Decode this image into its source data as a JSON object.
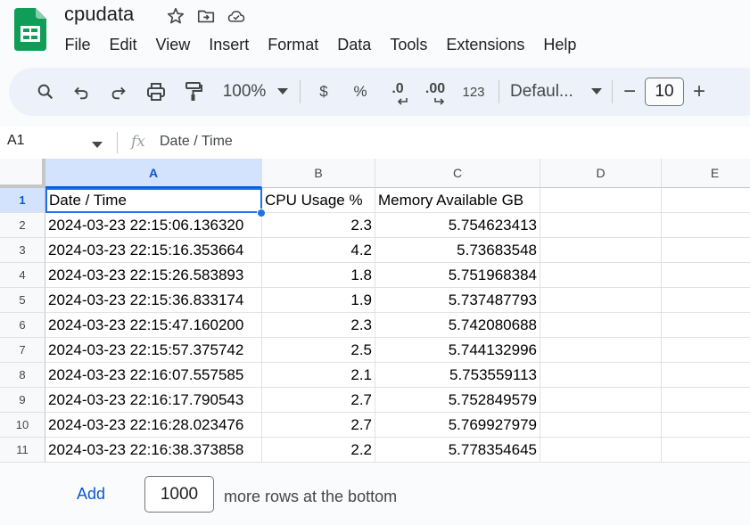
{
  "document": {
    "title": "cpudata"
  },
  "menu": [
    "File",
    "Edit",
    "View",
    "Insert",
    "Format",
    "Data",
    "Tools",
    "Extensions",
    "Help"
  ],
  "toolbar": {
    "zoom": "100%",
    "currency": "$",
    "percent": "%",
    "decrease_decimal": ".0",
    "increase_decimal": ".00",
    "number_format": "123",
    "font": "Defaul...",
    "font_size": "10",
    "decrease_size": "−",
    "increase_size": "+"
  },
  "formula_bar": {
    "cell_ref": "A1",
    "fx": "fx",
    "content": "Date / Time"
  },
  "columns": [
    "A",
    "B",
    "C",
    "D",
    "E"
  ],
  "rows": [
    {
      "num": "1",
      "a": "Date / Time",
      "b": "CPU Usage %",
      "c": "Memory Available GB"
    },
    {
      "num": "2",
      "a": "2024-03-23 22:15:06.136320",
      "b": "2.3",
      "c": "5.754623413"
    },
    {
      "num": "3",
      "a": "2024-03-23 22:15:16.353664",
      "b": "4.2",
      "c": "5.73683548"
    },
    {
      "num": "4",
      "a": "2024-03-23 22:15:26.583893",
      "b": "1.8",
      "c": "5.751968384"
    },
    {
      "num": "5",
      "a": "2024-03-23 22:15:36.833174",
      "b": "1.9",
      "c": "5.737487793"
    },
    {
      "num": "6",
      "a": "2024-03-23 22:15:47.160200",
      "b": "2.3",
      "c": "5.742080688"
    },
    {
      "num": "7",
      "a": "2024-03-23 22:15:57.375742",
      "b": "2.5",
      "c": "5.744132996"
    },
    {
      "num": "8",
      "a": "2024-03-23 22:16:07.557585",
      "b": "2.1",
      "c": "5.753559113"
    },
    {
      "num": "9",
      "a": "2024-03-23 22:16:17.790543",
      "b": "2.7",
      "c": "5.752849579"
    },
    {
      "num": "10",
      "a": "2024-03-23 22:16:28.023476",
      "b": "2.7",
      "c": "5.769927979"
    },
    {
      "num": "11",
      "a": "2024-03-23 22:16:38.373858",
      "b": "2.2",
      "c": "5.778354645"
    }
  ],
  "bottom": {
    "add_label": "Add",
    "rows_to_add": "1000",
    "suffix": "more rows at the bottom"
  },
  "colors": {
    "brand_green": "#0f9d58",
    "accent_blue": "#1a73e8",
    "selection_bg": "#d3e3fd"
  }
}
